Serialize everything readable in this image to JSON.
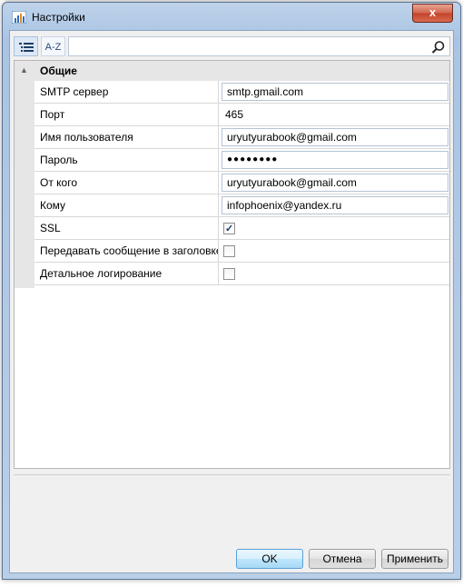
{
  "window": {
    "title": "Настройки",
    "close_label": "x"
  },
  "toolbar": {
    "categorized_icon": "categorized-list-icon",
    "az_label": "A-Z",
    "search_placeholder": "",
    "search_icon": "magnifier-icon"
  },
  "grid": {
    "category": "Общие",
    "rows": [
      {
        "name": "SMTP сервер",
        "value": "smtp.gmail.com",
        "kind": "text"
      },
      {
        "name": "Порт",
        "value": "465",
        "kind": "plain"
      },
      {
        "name": "Имя пользователя",
        "value": "uryutyurabook@gmail.com",
        "kind": "text"
      },
      {
        "name": "Пароль",
        "value": "●●●●●●●●",
        "kind": "password"
      },
      {
        "name": "От кого",
        "value": "uryutyurabook@gmail.com",
        "kind": "text"
      },
      {
        "name": "Кому",
        "value": "infophoenix@yandex.ru",
        "kind": "text"
      },
      {
        "name": "SSL",
        "value": true,
        "kind": "checkbox"
      },
      {
        "name": "Передавать сообщение в заголовке",
        "value": false,
        "kind": "checkbox"
      },
      {
        "name": "Детальное логирование",
        "value": false,
        "kind": "checkbox"
      }
    ]
  },
  "buttons": {
    "ok": "OK",
    "cancel": "Отмена",
    "apply": "Применить"
  }
}
